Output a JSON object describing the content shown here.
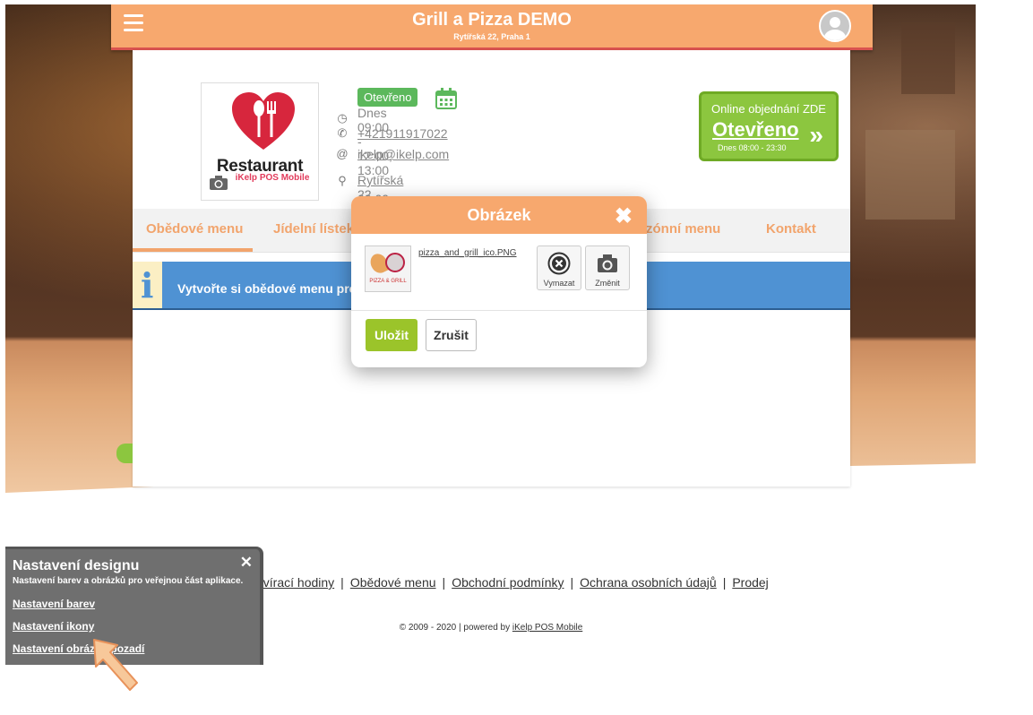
{
  "header": {
    "title": "Grill a Pizza DEMO",
    "address": "Rytířská 22, Praha 1",
    "menu_icon": "hamburger-menu-icon",
    "avatar_icon": "user-avatar-icon",
    "accent_color": "#f7a86e"
  },
  "restaurant": {
    "logo_text": "Restaurant",
    "logo_subtext": "iKelp POS Mobile",
    "status": "Otevřeno",
    "hours": "Dnes 09:00 - 12:00, 13:00 - 00:00",
    "phone": "+421911917022",
    "email": "ikelp@ikelp.com",
    "address_link": "Rytířská 22, 11000 Praha 1"
  },
  "order_button": {
    "line1": "Online objednání ZDE",
    "line2": "Otevřeno",
    "line3": "Dnes 08:00 - 23:30",
    "arrow": "»"
  },
  "tabs": [
    {
      "label": "Obědové menu",
      "active": true
    },
    {
      "label": "Jídelní lístek",
      "active": false
    },
    {
      "label": "zónní menu",
      "active": false
    },
    {
      "label": "Kontakt",
      "active": false
    }
  ],
  "alert": {
    "icon": "i",
    "text": "Vytvořte si obědové menu pro"
  },
  "modal": {
    "title": "Obrázek",
    "close": "✖",
    "filename": "pizza_and_grill_ico.PNG",
    "thumb_caption": "PIZZA & GRILL",
    "delete_label": "Vymazat",
    "change_label": "Změnit",
    "save_label": "Uložit",
    "cancel_label": "Zrušit"
  },
  "footer": {
    "links": [
      "evírací hodiny",
      "Obědové menu",
      "Obchodní podmínky",
      "Ochrana osobních údajů",
      "Prodej"
    ],
    "separator": "|",
    "copyright_prefix": "© 2009 - 2020 | powered by ",
    "copyright_link": "iKelp POS Mobile"
  },
  "design_panel": {
    "title": "Nastavení designu",
    "subtitle": "Nastavení barev a obrázků pro veřejnou část aplikace.",
    "close": "✕",
    "links": [
      "Nastavení barev",
      "Nastavení ikony",
      "Nastavení obrázků pozadí"
    ]
  }
}
